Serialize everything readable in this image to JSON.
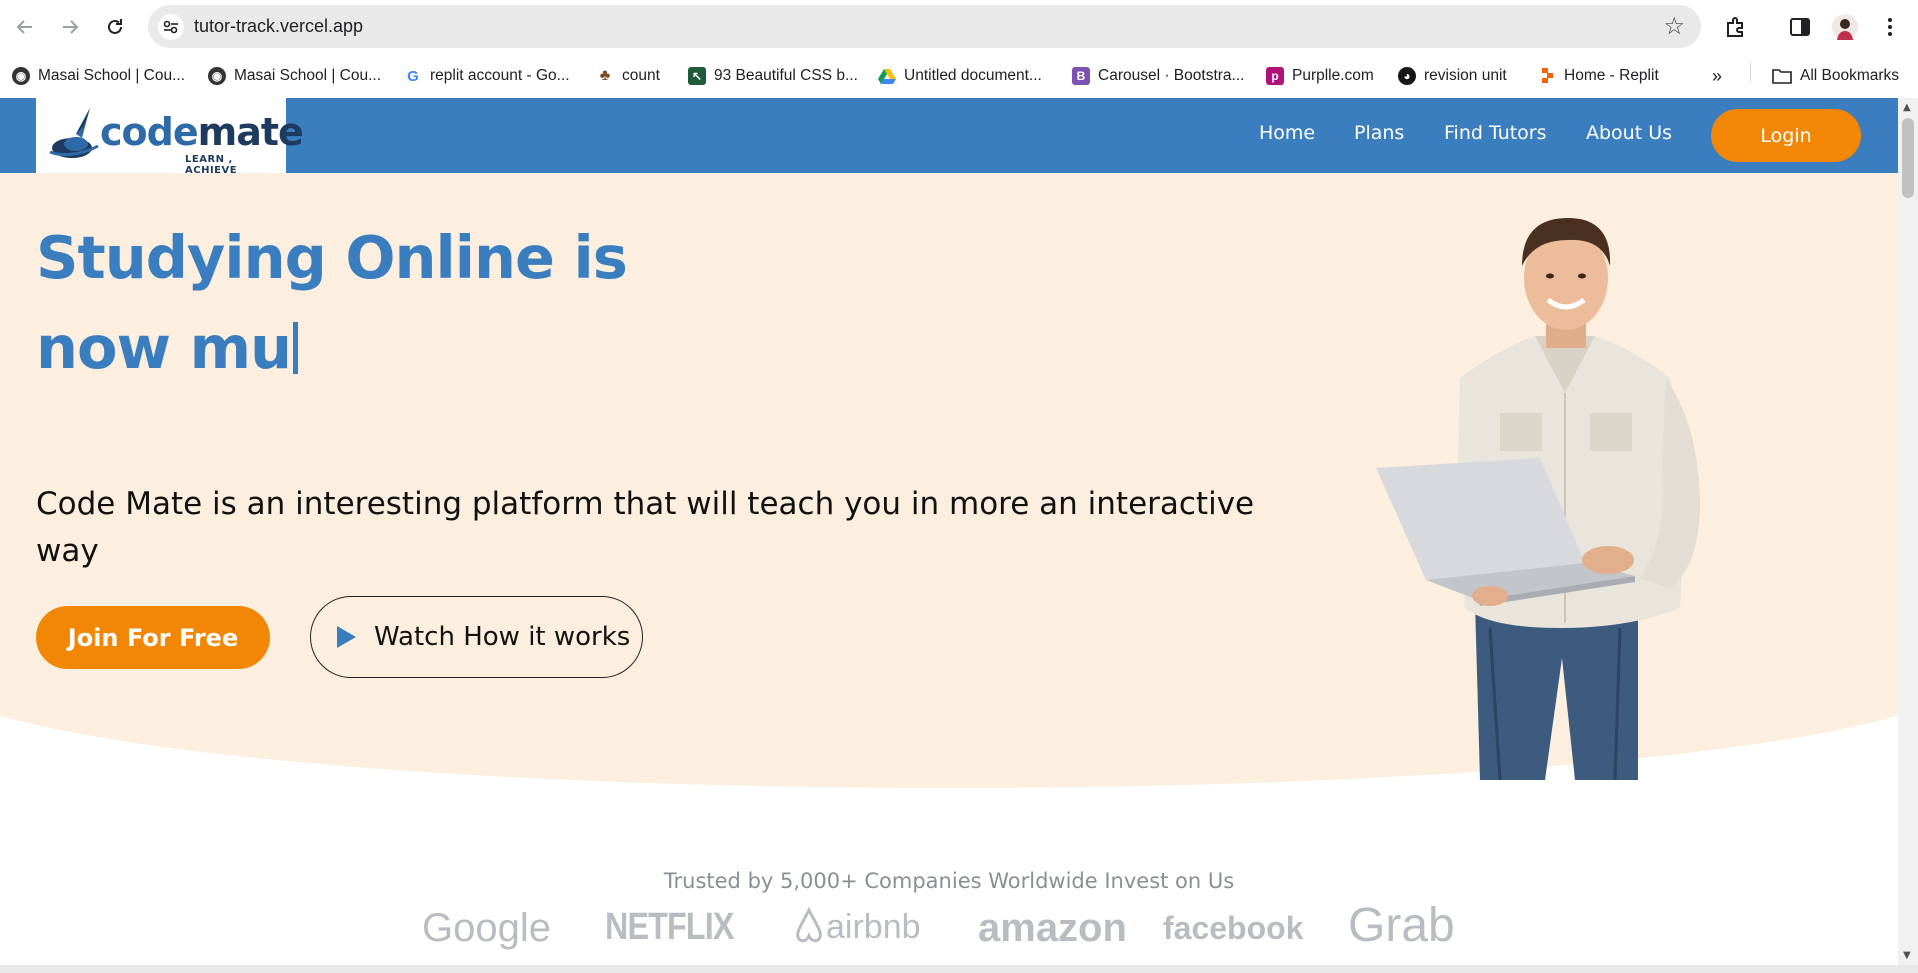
{
  "browser": {
    "url": "tutor-track.vercel.app",
    "bookmarks": [
      {
        "label": "Masai School | Cou...",
        "icon": "globe-icon",
        "color": "#333333"
      },
      {
        "label": "Masai School | Cou...",
        "icon": "globe-icon",
        "color": "#333333"
      },
      {
        "label": "replit account - Go...",
        "icon": "google-icon",
        "color": "#4285f4"
      },
      {
        "label": "count",
        "icon": "pin-icon",
        "color": "#7a4a2a"
      },
      {
        "label": "93 Beautiful CSS b...",
        "icon": "cursor-icon",
        "color": "#1f5a3a"
      },
      {
        "label": "Untitled document...",
        "icon": "drive-icon",
        "color": "#fbbc04"
      },
      {
        "label": "Carousel · Bootstra...",
        "icon": "bootstrap-icon",
        "color": "#7952b3"
      },
      {
        "label": "Purplle.com",
        "icon": "purplle-icon",
        "color": "#b0127a"
      },
      {
        "label": "revision unit",
        "icon": "github-icon",
        "color": "#181717"
      },
      {
        "label": "Home - Replit",
        "icon": "replit-icon",
        "color": "#f26207"
      }
    ],
    "all_bookmarks": "All Bookmarks"
  },
  "site": {
    "logo": {
      "code": "code",
      "mate": "mate",
      "tagline": "LEARN , ACHIEVE"
    },
    "nav": [
      "Home",
      "Plans",
      "Find Tutors",
      "About Us"
    ],
    "login": "Login",
    "accent": "#3a7ebf",
    "orange": "#f28705",
    "hero_bg": "#fdefe0"
  },
  "hero": {
    "title_line1": "Studying Online is",
    "title_line2": "now mu",
    "subtitle": "Code Mate is an interesting platform that will teach you in more an interactive way",
    "join_button": "Join For Free",
    "watch_button": "Watch How it works"
  },
  "trusted": {
    "text": "Trusted by 5,000+ Companies Worldwide Invest on Us",
    "brands": [
      "Google",
      "NETFLIX",
      "airbnb",
      "amazon",
      "facebook",
      "Grab"
    ]
  }
}
